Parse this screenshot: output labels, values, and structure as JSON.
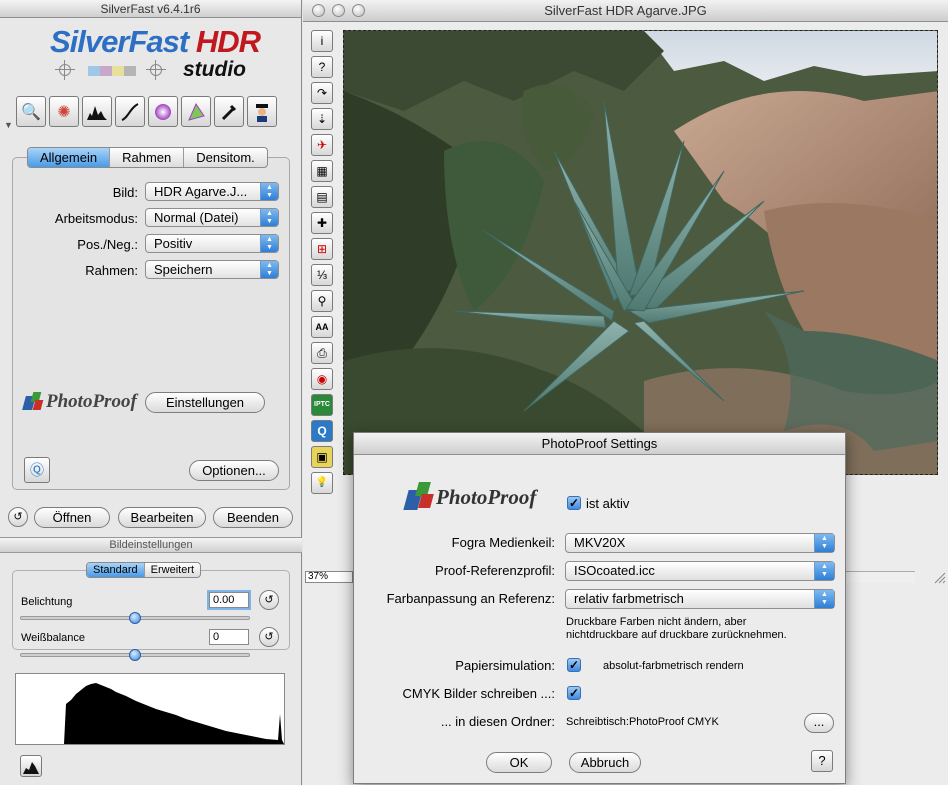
{
  "left_window": {
    "title": "SilverFast v6.4.1r6",
    "logo": {
      "brand": "SilverFast",
      "product": "HDR",
      "edition": "studio"
    },
    "toolbar_icons": [
      "magnifier-icon",
      "color-wheel-icon",
      "histogram-icon",
      "gradation-curve-icon",
      "selective-color-icon",
      "gamut-triangle-icon",
      "eyedropper-icon",
      "expert-icon"
    ],
    "tabs": [
      "Allgemein",
      "Rahmen",
      "Densitom."
    ],
    "active_tab": "Allgemein",
    "fields": [
      {
        "label": "Bild:",
        "value": "HDR Agarve.J..."
      },
      {
        "label": "Arbeitsmodus:",
        "value": "Normal (Datei)"
      },
      {
        "label": "Pos./Neg.:",
        "value": "Positiv"
      },
      {
        "label": "Rahmen:",
        "value": "Speichern"
      }
    ],
    "photoproof_label": "PhotoProof",
    "einstellungen_button": "Einstellungen",
    "optionen_button": "Optionen...",
    "bottom_buttons": {
      "open": "Öffnen",
      "edit": "Bearbeiten",
      "quit": "Beenden"
    },
    "bildeinstellungen": {
      "title": "Bildeinstellungen",
      "segments": [
        "Standard",
        "Erweitert"
      ],
      "active_segment": "Standard",
      "belichtung_label": "Belichtung",
      "belichtung_value": "0.00",
      "weissbalance_label": "Weißbalance",
      "weissbalance_value": "0"
    }
  },
  "image_window": {
    "title": "SilverFast HDR Agarve.JPG",
    "zoom": "37%",
    "side_tools": [
      "i",
      "?",
      "↷",
      "⇣",
      "✈",
      "▦",
      "▤",
      "✚",
      "⊞",
      "⅓",
      "⚲",
      "AA",
      "⎙",
      "◉",
      "IPTC",
      "Q",
      "▣",
      "💡"
    ]
  },
  "dialog": {
    "title": "PhotoProof Settings",
    "logo_text": "PhotoProof",
    "active_label": "ist aktiv",
    "rows": {
      "fogra_label": "Fogra Medienkeil:",
      "fogra_value": "MKV20X",
      "proof_label": "Proof-Referenzprofil:",
      "proof_value": "ISOcoated.icc",
      "farb_label": "Farbanpassung an Referenz:",
      "farb_value": "relativ farbmetrisch",
      "farb_note_1": "Druckbare Farben nicht ändern, aber",
      "farb_note_2": "nichtdruckbare auf druckbare zurücknehmen.",
      "papier_label": "Papiersimulation:",
      "papier_note": "absolut-farbmetrisch rendern",
      "cmyk_label": "CMYK Bilder schreiben ...:",
      "ordner_label": "... in diesen Ordner:",
      "ordner_value": "Schreibtisch:PhotoProof CMYK",
      "browse_label": "..."
    },
    "ok_label": "OK",
    "cancel_label": "Abbruch",
    "help_label": "?"
  },
  "colors": {
    "accent": "#3e8ae0",
    "logo_blue": "#2d6fc4",
    "logo_red": "#c0181e"
  }
}
